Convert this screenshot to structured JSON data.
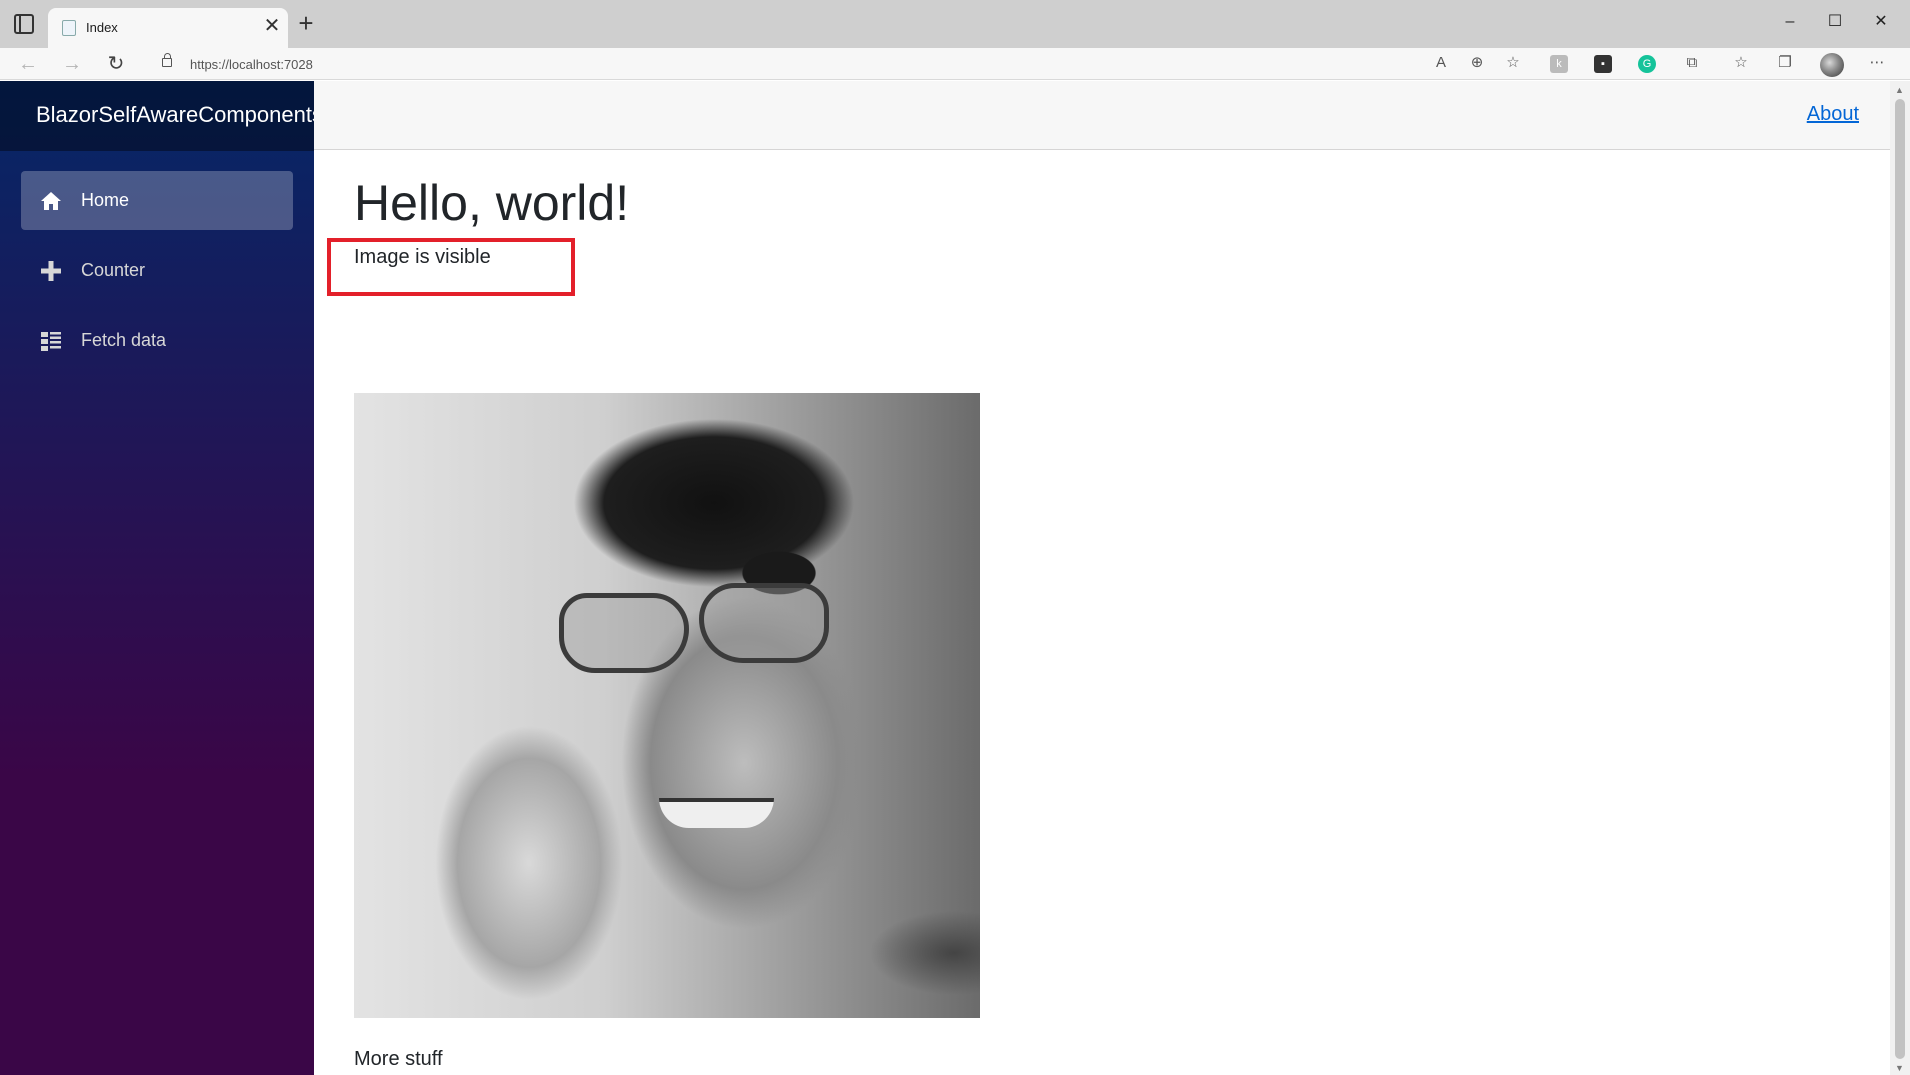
{
  "browser": {
    "tab_title": "Index",
    "tab_close": "✕",
    "new_tab": "+",
    "url": "https://localhost:7028",
    "window": {
      "minimize": "–",
      "maximize": "☐",
      "close": "✕"
    },
    "nav": {
      "back": "←",
      "forward": "→",
      "reload": "↻"
    },
    "icons": [
      "read-aloud-icon",
      "zoom-icon",
      "favorite-add-icon",
      "extension-icon",
      "extension-icon",
      "grammarly-icon",
      "extensions-icon",
      "favorites-icon",
      "collections-icon",
      "profile-icon",
      "more-icon"
    ]
  },
  "sidebar": {
    "brand": "BlazorSelfAwareComponents",
    "items": [
      {
        "label": "Home",
        "icon": "home-icon",
        "active": true
      },
      {
        "label": "Counter",
        "icon": "plus-icon",
        "active": false
      },
      {
        "label": "Fetch data",
        "icon": "list-icon",
        "active": false
      }
    ]
  },
  "header": {
    "about": "About"
  },
  "main": {
    "title": "Hello, world!",
    "status": "Image is visible",
    "image_icon": "portrait-photo",
    "more": "More stuff"
  },
  "colors": {
    "sidebar_top": "#052767",
    "sidebar_bottom": "#3a0647",
    "link": "#0366d6",
    "highlight_border": "#e3202a"
  }
}
